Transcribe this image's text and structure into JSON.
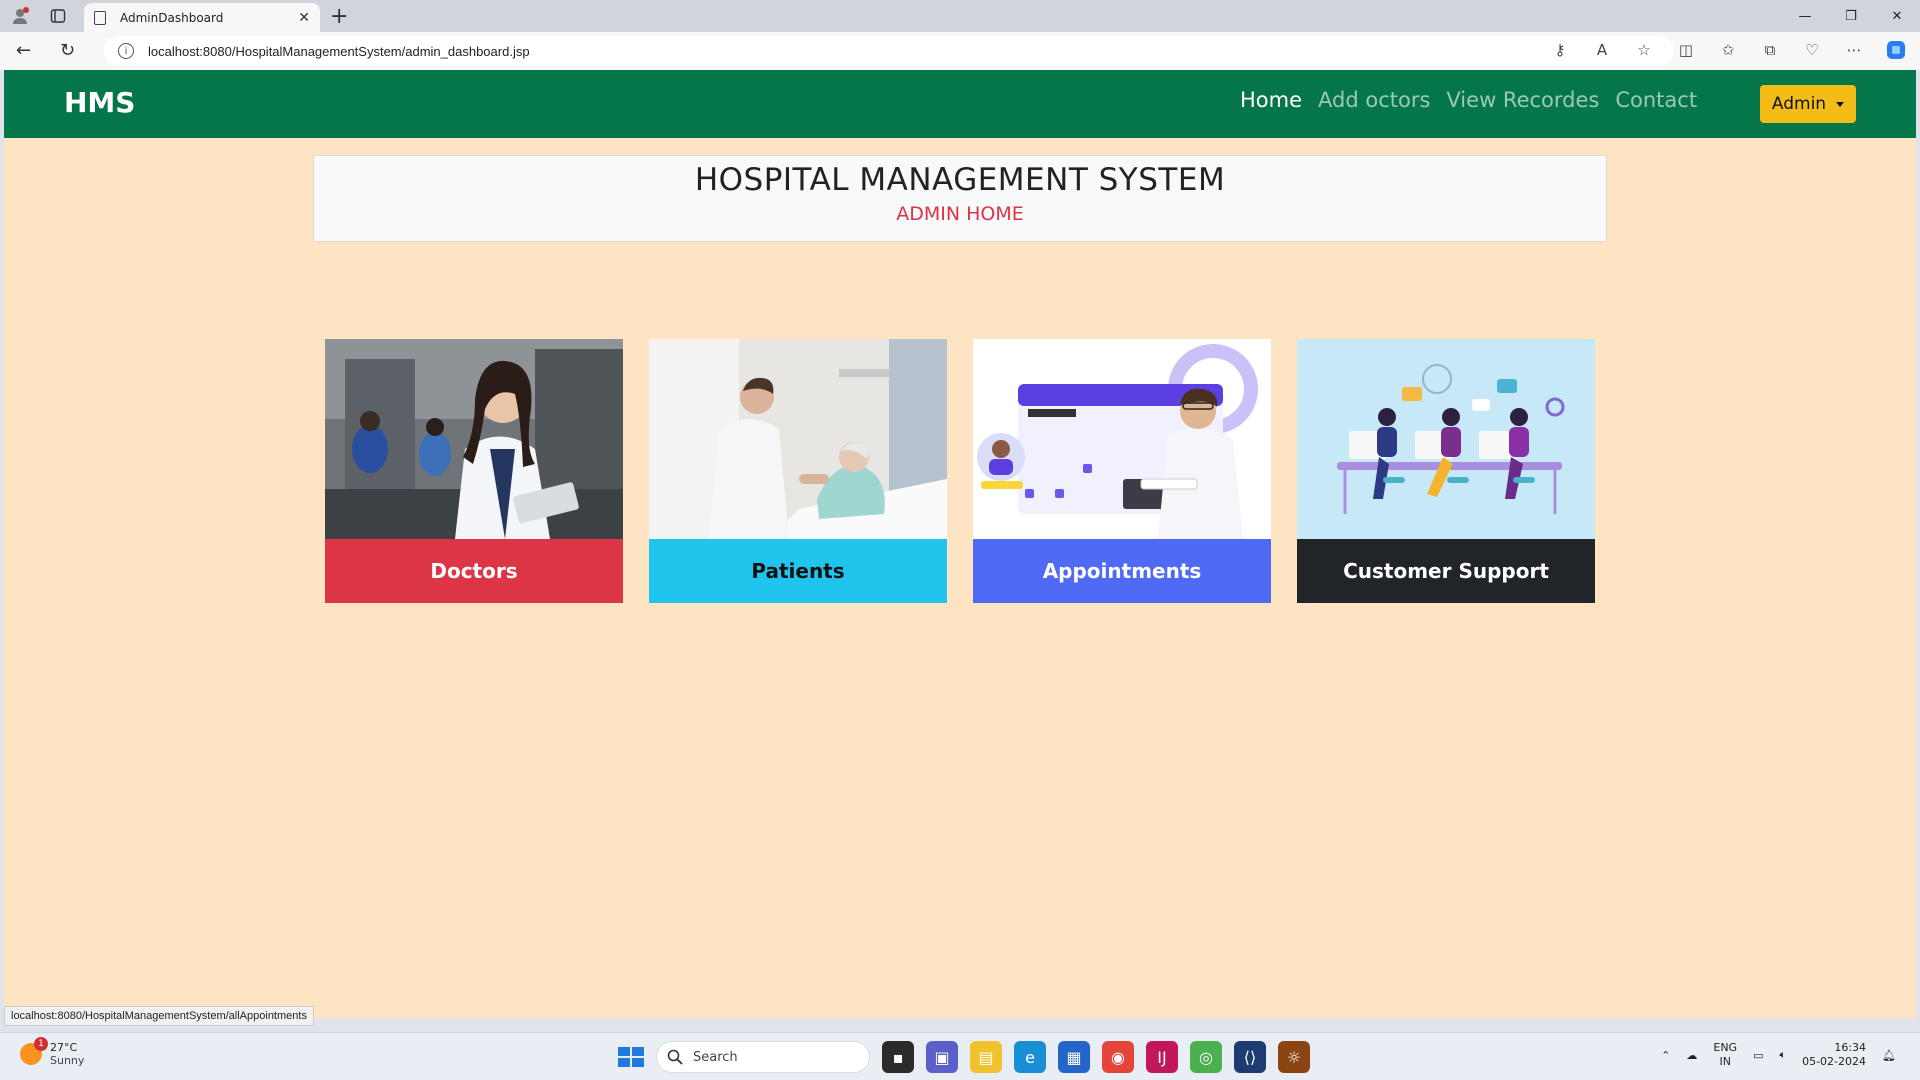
{
  "browser": {
    "tab_title": "AdminDashboard",
    "url": "localhost:8080/HospitalManagementSystem/admin_dashboard.jsp",
    "status_url": "localhost:8080/HospitalManagementSystem/allAppointments"
  },
  "navbar": {
    "brand": "HMS",
    "links": [
      {
        "label": "Home",
        "active": true
      },
      {
        "label": "Add octors",
        "active": false
      },
      {
        "label": "View Recordes",
        "active": false
      },
      {
        "label": "Contact",
        "active": false
      }
    ],
    "admin_label": "Admin",
    "color": "#04764a"
  },
  "hero": {
    "title": "HOSPITAL MANAGEMENT SYSTEM",
    "subtitle": "ADMIN HOME"
  },
  "cards": [
    {
      "label": "Doctors",
      "color": "#dc3545",
      "icon": "doctor-photo"
    },
    {
      "label": "Patients",
      "color": "#20c5ee",
      "icon": "patient-photo"
    },
    {
      "label": "Appointments",
      "color": "#4f6bf5",
      "icon": "appointment-illustration"
    },
    {
      "label": "Customer Support",
      "color": "#212529",
      "icon": "support-illustration"
    }
  ],
  "taskbar": {
    "weather_temp": "27°C",
    "weather_desc": "Sunny",
    "weather_badge": "1",
    "search_placeholder": "Search",
    "lang_top": "ENG",
    "lang_bottom": "IN",
    "time": "16:34",
    "date": "05-02-2024"
  }
}
